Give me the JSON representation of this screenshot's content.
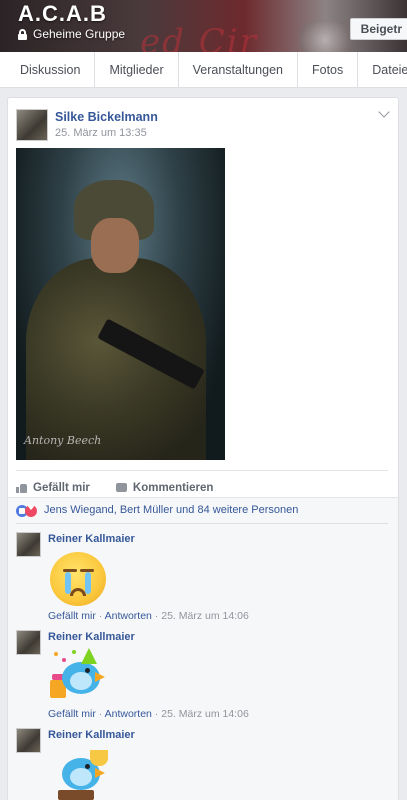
{
  "group": {
    "title": "A.C.A.B",
    "type_label": "Geheime Gruppe",
    "join_label": "Beigetr"
  },
  "tabs": [
    "Diskussion",
    "Mitglieder",
    "Veranstaltungen",
    "Fotos",
    "Dateien"
  ],
  "post": {
    "author": "Silke Bickelmann",
    "timestamp": "25. März um 13:35",
    "photo_signature": "Antony Beech",
    "like_label": "Gefällt mir",
    "comment_label": "Kommentieren",
    "reactions_text": "Jens Wiegand, Bert Müller und 84 weitere Personen"
  },
  "comments": [
    {
      "author": "Reiner Kallmaier",
      "sticker": "sad-crying-face-icon",
      "like_label": "Gefällt mir",
      "reply_label": "Antworten",
      "time": "25. März um 14:06"
    },
    {
      "author": "Reiner Kallmaier",
      "sticker": "birthday-bird-icon",
      "like_label": "Gefällt mir",
      "reply_label": "Antworten",
      "time": "25. März um 14:06"
    },
    {
      "author": "Reiner Kallmaier",
      "sticker": "trophy-bird-icon"
    }
  ],
  "colors": {
    "link_blue": "#365899",
    "page_bg": "#e9ebee",
    "meta_gray": "#90949c"
  }
}
